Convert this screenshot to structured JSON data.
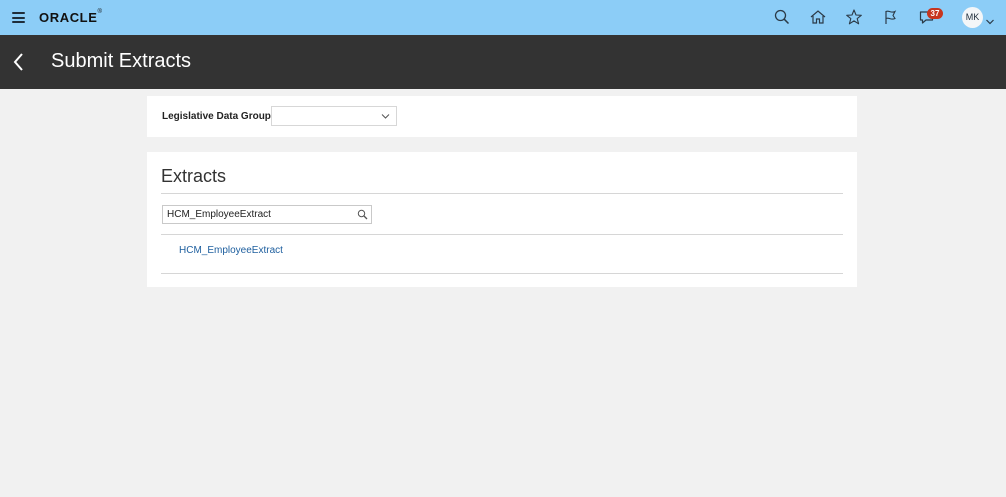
{
  "header": {
    "logo_text": "ORACLE",
    "logo_mark": "®",
    "notifications_count": "37",
    "user_initials": "MK",
    "icons": [
      "menu-icon",
      "search-icon",
      "home-icon",
      "star-icon",
      "flag-icon",
      "notifications-icon",
      "chevron-down-icon"
    ],
    "colors": {
      "header_bg": "#8ccdf7",
      "badge": "#c7361f"
    }
  },
  "titlebar": {
    "title": "Submit Extracts",
    "back_icon": "chevron-left-icon",
    "colors": {
      "bg": "#333333",
      "text": "#ffffff"
    }
  },
  "ldg": {
    "label": "Legislative Data Group",
    "selected": ""
  },
  "extracts": {
    "title": "Extracts",
    "search_value": "HCM_EmployeeExtract",
    "results": [
      "HCM_EmployeeExtract"
    ],
    "colors": {
      "link": "#1d5e9e"
    }
  }
}
